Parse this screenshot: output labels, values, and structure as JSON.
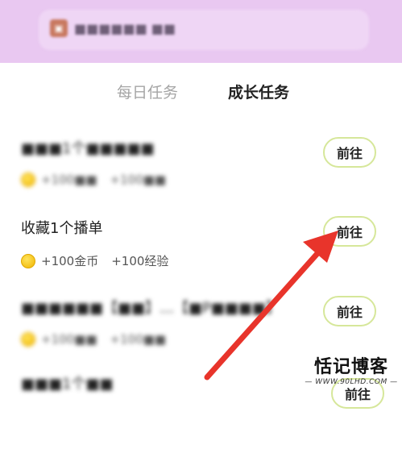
{
  "header": {
    "icon": "gift-icon",
    "title": "■■■■■■ ■■"
  },
  "tabs": {
    "daily": "每日任务",
    "growth": "成长任务"
  },
  "tasks": [
    {
      "title": "■■■1个■■■■■",
      "rewards": [
        "+100■■",
        "+100■■"
      ],
      "button": "前往",
      "blurred": true
    },
    {
      "title": "收藏1个播单",
      "rewards": [
        "+100金币",
        "+100经验"
      ],
      "button": "前往",
      "blurred": false
    },
    {
      "title": "■■■■■■【■■】…【■P■■■■】",
      "rewards": [
        "+100■■",
        "+100■■"
      ],
      "button": "前往",
      "blurred": true
    },
    {
      "title": "■■■1个■■",
      "button": "前往",
      "blurred": true
    }
  ],
  "watermark": {
    "main": "恬记博客",
    "sub": "— WWW.90LHD.COM —"
  },
  "colors": {
    "header_bg": "#e9c8f1",
    "button_border": "#d6e79a",
    "arrow": "#e8342b"
  }
}
